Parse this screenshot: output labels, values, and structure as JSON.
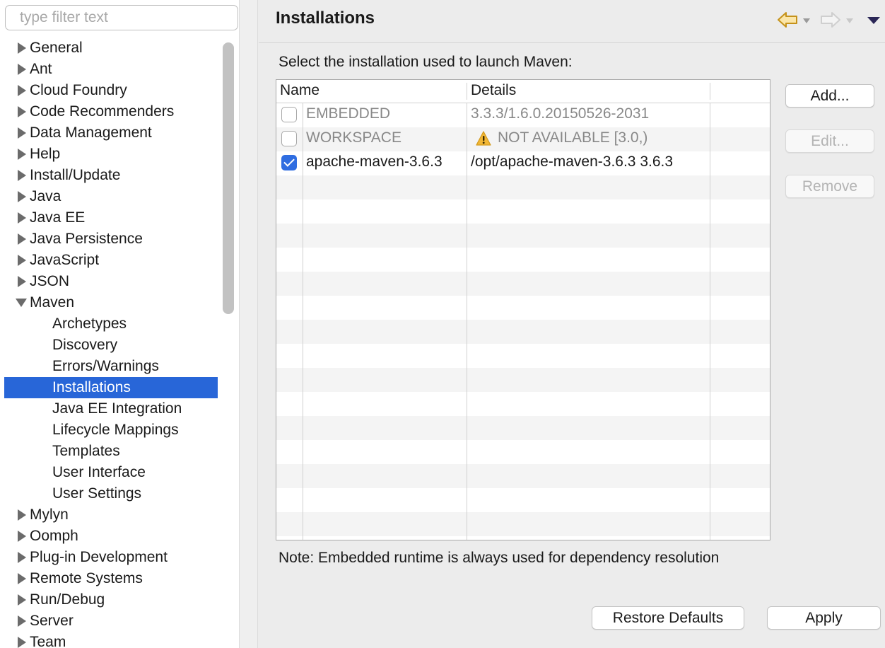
{
  "filter": {
    "placeholder": "type filter text"
  },
  "tree": [
    {
      "label": "General",
      "state": "closed"
    },
    {
      "label": "Ant",
      "state": "closed"
    },
    {
      "label": "Cloud Foundry",
      "state": "closed"
    },
    {
      "label": "Code Recommenders",
      "state": "closed"
    },
    {
      "label": "Data Management",
      "state": "closed"
    },
    {
      "label": "Help",
      "state": "closed"
    },
    {
      "label": "Install/Update",
      "state": "closed"
    },
    {
      "label": "Java",
      "state": "closed"
    },
    {
      "label": "Java EE",
      "state": "closed"
    },
    {
      "label": "Java Persistence",
      "state": "closed"
    },
    {
      "label": "JavaScript",
      "state": "closed"
    },
    {
      "label": "JSON",
      "state": "closed"
    },
    {
      "label": "Maven",
      "state": "open"
    },
    {
      "label": "Archetypes",
      "state": "child"
    },
    {
      "label": "Discovery",
      "state": "child"
    },
    {
      "label": "Errors/Warnings",
      "state": "child"
    },
    {
      "label": "Installations",
      "state": "child",
      "selected": true
    },
    {
      "label": "Java EE Integration",
      "state": "child"
    },
    {
      "label": "Lifecycle Mappings",
      "state": "child"
    },
    {
      "label": "Templates",
      "state": "child"
    },
    {
      "label": "User Interface",
      "state": "child"
    },
    {
      "label": "User Settings",
      "state": "child"
    },
    {
      "label": "Mylyn",
      "state": "closed"
    },
    {
      "label": "Oomph",
      "state": "closed"
    },
    {
      "label": "Plug-in Development",
      "state": "closed"
    },
    {
      "label": "Remote Systems",
      "state": "closed"
    },
    {
      "label": "Run/Debug",
      "state": "closed"
    },
    {
      "label": "Server",
      "state": "closed"
    },
    {
      "label": "Team",
      "state": "closed"
    }
  ],
  "page": {
    "title": "Installations",
    "prompt": "Select the installation used to launch Maven:",
    "note": "Note: Embedded runtime is always used for dependency resolution"
  },
  "table": {
    "headers": [
      "Name",
      "Details"
    ],
    "rows": [
      {
        "checked": false,
        "name": "EMBEDDED",
        "details": "3.3.3/1.6.0.20150526-2031",
        "muted": true,
        "warning": false
      },
      {
        "checked": false,
        "name": "WORKSPACE",
        "details": "NOT AVAILABLE [3.0,)",
        "muted": true,
        "warning": true
      },
      {
        "checked": true,
        "name": "apache-maven-3.6.3",
        "details": "/opt/apache-maven-3.6.3 3.6.3",
        "muted": false,
        "warning": false
      }
    ]
  },
  "buttons": {
    "add": "Add...",
    "edit": "Edit...",
    "remove": "Remove",
    "restore": "Restore Defaults",
    "apply": "Apply"
  },
  "colors": {
    "selection": "#2866d8",
    "checkbox": "#2f6de1",
    "nav_arrow": "#d6a21a",
    "warning": "#f2b736"
  },
  "icons": {
    "back": "back-arrow-icon",
    "forward": "forward-arrow-icon",
    "menu": "view-menu-icon",
    "warning": "warning-icon"
  }
}
